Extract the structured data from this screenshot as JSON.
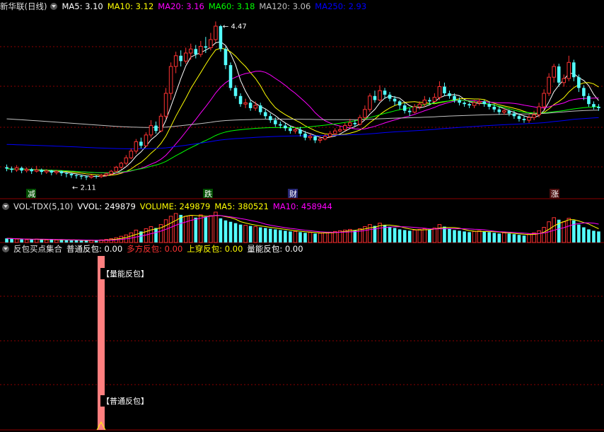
{
  "main": {
    "title": "新华联(日线)",
    "ma_labels": [
      {
        "key": "MA5",
        "value": "3.10",
        "color": "#ffffff"
      },
      {
        "key": "MA10",
        "value": "3.12",
        "color": "#ffff00"
      },
      {
        "key": "MA20",
        "value": "3.16",
        "color": "#ff00ff"
      },
      {
        "key": "MA60",
        "value": "3.18",
        "color": "#00ff00"
      },
      {
        "key": "MA120",
        "value": "3.06",
        "color": "#c0c0c0"
      },
      {
        "key": "MA250",
        "value": "2.93",
        "color": "#0000ff"
      }
    ],
    "high_marker": "4.47",
    "low_marker": "2.11",
    "tags": [
      "减",
      "跌",
      "财",
      "涨"
    ]
  },
  "volume": {
    "title": "VOL-TDX(5,10)",
    "labels": [
      {
        "key": "VVOL",
        "value": "249879",
        "color": "#ffffff"
      },
      {
        "key": "VOLUME",
        "value": "249879",
        "color": "#ffff00"
      },
      {
        "key": "MA5",
        "value": "380521",
        "color": "#ffff00"
      },
      {
        "key": "MA10",
        "value": "458944",
        "color": "#ff00ff"
      }
    ]
  },
  "indicator": {
    "title": "反包买点集合",
    "labels": [
      {
        "key": "普通反包",
        "value": "0.00",
        "color": "#ffffff"
      },
      {
        "key": "多方反包",
        "value": "0.00",
        "color": "#ff3333"
      },
      {
        "key": "上穿反包",
        "value": "0.00",
        "color": "#ffff00"
      },
      {
        "key": "量能反包",
        "value": "0.00",
        "color": "#ffffff"
      }
    ],
    "signal_label_top": "【量能反包】",
    "signal_label_bottom": "【普通反包】"
  },
  "colors": {
    "up": "#ff3232",
    "down": "#54ffff",
    "grid": "#8b0000",
    "bg": "#000000"
  },
  "icons": [
    "dropdown-circle-icon",
    "arrow-marker-icon"
  ],
  "chart_data": {
    "type": "candlestick",
    "title": "新华联(日线)",
    "price_range": [
      2.0,
      4.6
    ],
    "high": 4.47,
    "low": 2.11,
    "candles": [
      [
        2.3,
        2.28,
        2.34,
        2.24
      ],
      [
        2.28,
        2.26,
        2.31,
        2.22
      ],
      [
        2.26,
        2.29,
        2.33,
        2.23
      ],
      [
        2.29,
        2.25,
        2.31,
        2.21
      ],
      [
        2.25,
        2.27,
        2.3,
        2.22
      ],
      [
        2.27,
        2.24,
        2.29,
        2.2
      ],
      [
        2.24,
        2.26,
        2.32,
        2.22
      ],
      [
        2.26,
        2.23,
        2.28,
        2.19
      ],
      [
        2.23,
        2.25,
        2.27,
        2.2
      ],
      [
        2.25,
        2.22,
        2.26,
        2.18
      ],
      [
        2.22,
        2.24,
        2.26,
        2.19
      ],
      [
        2.24,
        2.21,
        2.25,
        2.17
      ],
      [
        2.21,
        2.2,
        2.23,
        2.15
      ],
      [
        2.2,
        2.18,
        2.22,
        2.14
      ],
      [
        2.18,
        2.17,
        2.2,
        2.13
      ],
      [
        2.17,
        2.16,
        2.19,
        2.12
      ],
      [
        2.16,
        2.15,
        2.18,
        2.11
      ],
      [
        2.15,
        2.17,
        2.19,
        2.13
      ],
      [
        2.17,
        2.16,
        2.18,
        2.13
      ],
      [
        2.16,
        2.18,
        2.2,
        2.14
      ],
      [
        2.18,
        2.2,
        2.22,
        2.16
      ],
      [
        2.2,
        2.24,
        2.26,
        2.18
      ],
      [
        2.24,
        2.3,
        2.32,
        2.22
      ],
      [
        2.3,
        2.36,
        2.38,
        2.27
      ],
      [
        2.36,
        2.44,
        2.48,
        2.33
      ],
      [
        2.44,
        2.54,
        2.58,
        2.42
      ],
      [
        2.54,
        2.68,
        2.72,
        2.5
      ],
      [
        2.68,
        2.62,
        2.74,
        2.58
      ],
      [
        2.62,
        2.78,
        2.82,
        2.6
      ],
      [
        2.78,
        2.92,
        3.0,
        2.74
      ],
      [
        2.92,
        2.84,
        2.98,
        2.8
      ],
      [
        2.84,
        3.06,
        3.1,
        2.82
      ],
      [
        3.06,
        3.4,
        3.48,
        3.02
      ],
      [
        3.4,
        3.8,
        3.86,
        3.3
      ],
      [
        3.8,
        3.96,
        4.02,
        3.7
      ],
      [
        3.96,
        3.88,
        4.04,
        3.8
      ],
      [
        3.88,
        4.0,
        4.08,
        3.84
      ],
      [
        4.0,
        4.06,
        4.14,
        3.9
      ],
      [
        4.06,
        3.98,
        4.12,
        3.92
      ],
      [
        3.98,
        4.1,
        4.18,
        3.94
      ],
      [
        4.1,
        4.08,
        4.24,
        4.0
      ],
      [
        4.08,
        4.2,
        4.3,
        4.04
      ],
      [
        4.2,
        4.4,
        4.47,
        4.16
      ],
      [
        4.4,
        4.06,
        4.42,
        4.02
      ],
      [
        4.06,
        3.82,
        4.1,
        3.76
      ],
      [
        3.82,
        3.48,
        3.86,
        3.44
      ],
      [
        3.48,
        3.36,
        3.52,
        3.32
      ],
      [
        3.36,
        3.24,
        3.4,
        3.2
      ],
      [
        3.24,
        3.26,
        3.32,
        3.18
      ],
      [
        3.26,
        3.18,
        3.3,
        3.14
      ],
      [
        3.18,
        3.22,
        3.28,
        3.14
      ],
      [
        3.22,
        3.12,
        3.26,
        3.08
      ],
      [
        3.12,
        3.06,
        3.16,
        3.02
      ],
      [
        3.06,
        3.0,
        3.1,
        2.96
      ],
      [
        3.0,
        2.94,
        3.04,
        2.9
      ],
      [
        2.94,
        2.92,
        2.98,
        2.88
      ],
      [
        2.92,
        2.88,
        2.96,
        2.84
      ],
      [
        2.88,
        2.84,
        2.92,
        2.8
      ],
      [
        2.84,
        2.86,
        2.9,
        2.8
      ],
      [
        2.86,
        2.8,
        2.9,
        2.76
      ],
      [
        2.8,
        2.74,
        2.84,
        2.7
      ],
      [
        2.74,
        2.76,
        2.8,
        2.7
      ],
      [
        2.76,
        2.7,
        2.78,
        2.66
      ],
      [
        2.7,
        2.72,
        2.76,
        2.66
      ],
      [
        2.72,
        2.76,
        2.8,
        2.7
      ],
      [
        2.76,
        2.8,
        2.84,
        2.74
      ],
      [
        2.8,
        2.84,
        2.88,
        2.78
      ],
      [
        2.84,
        2.86,
        2.92,
        2.82
      ],
      [
        2.86,
        2.92,
        2.96,
        2.84
      ],
      [
        2.92,
        2.96,
        3.02,
        2.88
      ],
      [
        2.96,
        2.94,
        3.0,
        2.9
      ],
      [
        2.94,
        3.04,
        3.08,
        2.92
      ],
      [
        3.04,
        3.16,
        3.22,
        3.0
      ],
      [
        3.16,
        3.36,
        3.4,
        3.12
      ],
      [
        3.36,
        3.3,
        3.44,
        3.26
      ],
      [
        3.3,
        3.44,
        3.52,
        3.28
      ],
      [
        3.44,
        3.38,
        3.48,
        3.32
      ],
      [
        3.38,
        3.32,
        3.42,
        3.28
      ],
      [
        3.32,
        3.28,
        3.36,
        3.22
      ],
      [
        3.28,
        3.22,
        3.3,
        3.16
      ],
      [
        3.22,
        3.14,
        3.26,
        3.1
      ],
      [
        3.14,
        3.12,
        3.18,
        3.06
      ],
      [
        3.12,
        3.2,
        3.24,
        3.1
      ],
      [
        3.2,
        3.24,
        3.28,
        3.16
      ],
      [
        3.24,
        3.3,
        3.36,
        3.2
      ],
      [
        3.3,
        3.28,
        3.34,
        3.24
      ],
      [
        3.28,
        3.34,
        3.4,
        3.26
      ],
      [
        3.34,
        3.5,
        3.58,
        3.3
      ],
      [
        3.5,
        3.4,
        3.56,
        3.36
      ],
      [
        3.4,
        3.36,
        3.44,
        3.32
      ],
      [
        3.36,
        3.3,
        3.4,
        3.26
      ],
      [
        3.3,
        3.26,
        3.34,
        3.22
      ],
      [
        3.26,
        3.24,
        3.28,
        3.2
      ],
      [
        3.24,
        3.22,
        3.26,
        3.18
      ],
      [
        3.22,
        3.26,
        3.3,
        3.18
      ],
      [
        3.26,
        3.28,
        3.32,
        3.22
      ],
      [
        3.28,
        3.24,
        3.3,
        3.2
      ],
      [
        3.24,
        3.2,
        3.28,
        3.16
      ],
      [
        3.2,
        3.16,
        3.24,
        3.12
      ],
      [
        3.16,
        3.12,
        3.2,
        3.08
      ],
      [
        3.12,
        3.14,
        3.18,
        3.08
      ],
      [
        3.14,
        3.1,
        3.16,
        3.06
      ],
      [
        3.1,
        3.06,
        3.14,
        3.02
      ],
      [
        3.06,
        3.02,
        3.1,
        2.98
      ],
      [
        3.02,
        3.0,
        3.06,
        2.96
      ],
      [
        3.0,
        3.04,
        3.08,
        2.96
      ],
      [
        3.04,
        3.08,
        3.14,
        3.0
      ],
      [
        3.08,
        3.2,
        3.26,
        3.04
      ],
      [
        3.2,
        3.4,
        3.46,
        3.16
      ],
      [
        3.4,
        3.64,
        3.7,
        3.36
      ],
      [
        3.64,
        3.8,
        3.84,
        3.56
      ],
      [
        3.8,
        3.56,
        3.84,
        3.5
      ],
      [
        3.56,
        3.62,
        3.68,
        3.5
      ],
      [
        3.62,
        3.86,
        3.96,
        3.58
      ],
      [
        3.86,
        3.64,
        3.9,
        3.58
      ],
      [
        3.64,
        3.48,
        3.68,
        3.42
      ],
      [
        3.48,
        3.36,
        3.52,
        3.3
      ],
      [
        3.36,
        3.24,
        3.4,
        3.2
      ],
      [
        3.24,
        3.2,
        3.28,
        3.16
      ],
      [
        3.2,
        3.18,
        3.24,
        3.14
      ]
    ],
    "volume": [
      60,
      55,
      50,
      45,
      40,
      45,
      50,
      40,
      38,
      42,
      36,
      40,
      34,
      30,
      32,
      28,
      26,
      35,
      30,
      38,
      45,
      55,
      70,
      90,
      110,
      140,
      180,
      160,
      200,
      230,
      210,
      260,
      330,
      380,
      420,
      400,
      380,
      390,
      360,
      400,
      370,
      390,
      440,
      350,
      320,
      300,
      280,
      260,
      250,
      240,
      230,
      220,
      210,
      200,
      190,
      180,
      170,
      160,
      160,
      150,
      140,
      145,
      130,
      135,
      140,
      150,
      160,
      170,
      180,
      190,
      180,
      200,
      230,
      260,
      240,
      280,
      250,
      230,
      210,
      190,
      180,
      170,
      180,
      190,
      200,
      190,
      210,
      260,
      230,
      200,
      180,
      170,
      160,
      150,
      160,
      170,
      160,
      150,
      140,
      130,
      140,
      130,
      120,
      110,
      100,
      120,
      140,
      170,
      220,
      300,
      360,
      330,
      300,
      350,
      320,
      260,
      220,
      190,
      170,
      160
    ],
    "signal_index": 17
  }
}
